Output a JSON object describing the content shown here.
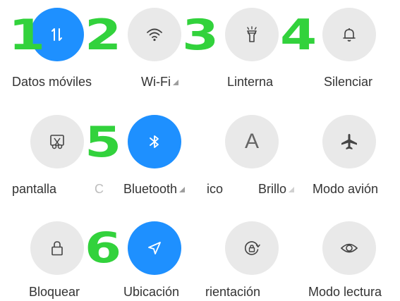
{
  "tiles": [
    {
      "label": "Datos móviles",
      "icon": "mobile-data-icon",
      "active": true
    },
    {
      "label": "Wi-Fi",
      "icon": "wifi-icon",
      "active": false
    },
    {
      "label": "Linterna",
      "icon": "flashlight-icon",
      "active": false
    },
    {
      "label": "Silenciar",
      "icon": "bell-icon",
      "active": false
    },
    {
      "label": "pantalla",
      "icon": "screenshot-scissors-icon",
      "active": false
    },
    {
      "label": "C",
      "icon": "",
      "active": false
    },
    {
      "label": "Bluetooth",
      "icon": "bluetooth-icon",
      "active": true
    },
    {
      "label": "ico",
      "icon": "",
      "active": false
    },
    {
      "label": "Brillo",
      "icon": "brightness-auto-icon",
      "active": false
    },
    {
      "label": "Modo avión",
      "icon": "airplane-icon",
      "active": false
    },
    {
      "label": "Bloquear",
      "icon": "lock-icon",
      "active": false
    },
    {
      "label": "Ubicación",
      "icon": "location-arrow-icon",
      "active": true
    },
    {
      "label": "rientación",
      "icon": "rotation-lock-icon",
      "active": false
    },
    {
      "label": "Modo lectura",
      "icon": "eye-icon",
      "active": false
    }
  ],
  "brightness_icon_letter": "A",
  "markers": [
    "1",
    "2",
    "3",
    "4",
    "5",
    "6"
  ],
  "colors": {
    "active": "#1e90ff",
    "inactive": "#e9e9e9",
    "marker": "#32d23c"
  }
}
